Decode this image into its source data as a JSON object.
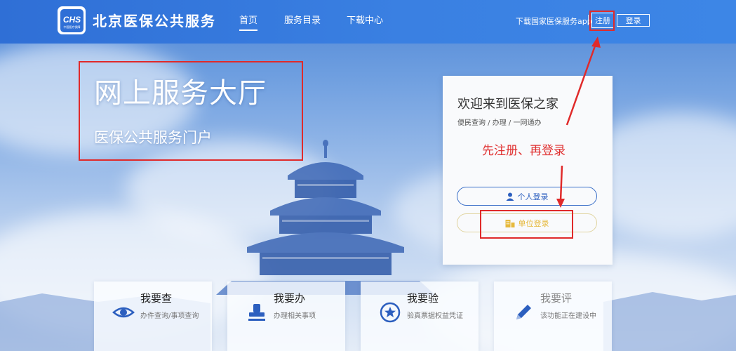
{
  "header": {
    "logo_text": "CHS",
    "logo_subtext": "中国医疗保障",
    "site_title": "北京医保公共服务",
    "nav": [
      {
        "label": "首页",
        "active": true
      },
      {
        "label": "服务目录",
        "active": false
      },
      {
        "label": "下载中心",
        "active": false
      }
    ],
    "download_app": "下载国家医保服务app",
    "register_label": "注册",
    "login_label": "登录"
  },
  "hero": {
    "title": "网上服务大厅",
    "subtitle": "医保公共服务门户"
  },
  "login_card": {
    "title": "欢迎来到医保之家",
    "subtitle": "便民查询 / 办理 / 一网通办",
    "note": "先注册、再登录",
    "personal_login": "个人登录",
    "unit_login": "单位登录"
  },
  "services": [
    {
      "title": "我要查",
      "desc": "办件查询/事项查询",
      "icon": "eye-icon"
    },
    {
      "title": "我要办",
      "desc": "办理相关事项",
      "icon": "stamp-icon"
    },
    {
      "title": "我要验",
      "desc": "验真票据权益凭证",
      "icon": "badge-star-icon"
    },
    {
      "title": "我要评",
      "desc": "该功能正在建设中",
      "icon": "pen-icon"
    }
  ],
  "colors": {
    "header_blue": "#3a80e2",
    "primary_blue": "#2c5fbf",
    "unit_gold": "#e6b93c",
    "annotation_red": "#e02a2a"
  }
}
